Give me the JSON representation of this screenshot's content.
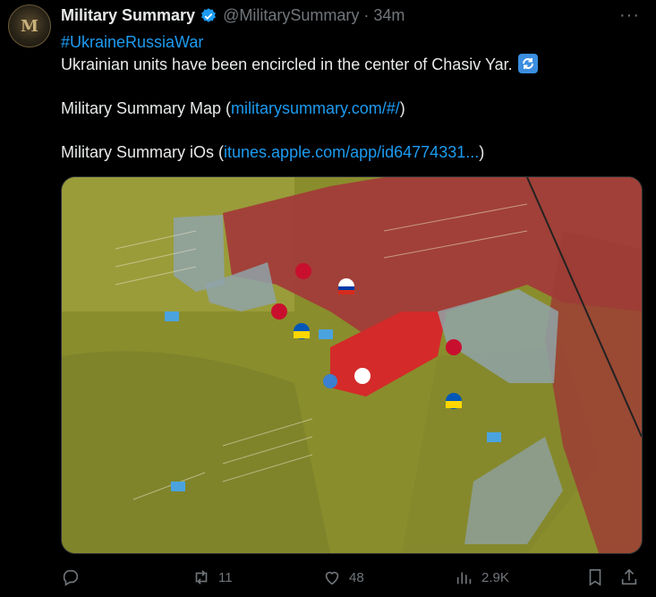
{
  "tweet": {
    "avatar_monogram": "M",
    "display_name": "Military Summary",
    "handle": "@MilitarySummary",
    "separator": "·",
    "time": "34m",
    "hashtag": "#UkraineRussiaWar",
    "line1": "Ukrainian units have been encircled in the center of Chasiv Yar.",
    "map_label": "Military Summary Map (",
    "map_link": "militarysummary.com/#/",
    "map_close": ")",
    "ios_label": "Military Summary iOs (",
    "ios_link": "itunes.apple.com/app/id64774331...",
    "ios_close": ")"
  },
  "actions": {
    "reply_count": "",
    "retweet_count": "11",
    "like_count": "48",
    "views_count": "2.9K"
  },
  "colors": {
    "background": "#000000",
    "link": "#1d9bf0",
    "muted": "#71767b",
    "russian_zone": "#b23a3a",
    "contested": "#d42a2a",
    "ukrainian_zone": "#8c8f2a",
    "urban_grey": "#8fa3a8"
  },
  "icons": [
    "verified-badge-icon",
    "more-icon",
    "refresh-emoji-icon",
    "reply-icon",
    "retweet-icon",
    "like-icon",
    "views-icon",
    "bookmark-icon",
    "share-icon"
  ]
}
